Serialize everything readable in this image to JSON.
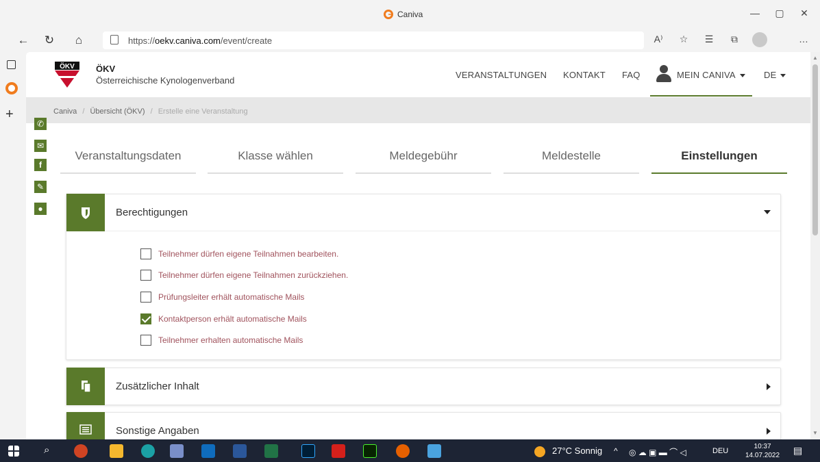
{
  "window": {
    "title": "Caniva"
  },
  "browser": {
    "url_prefix": "https://",
    "url_domain": "oekv.caniva.com",
    "url_path": "/event/create"
  },
  "site": {
    "brand": "ÖKV",
    "subtitle": "Österreichische Kynologenverband",
    "nav": {
      "events": "VERANSTALTUNGEN",
      "contact": "KONTAKT",
      "faq": "FAQ",
      "my_caniva": "MEIN CANIVA",
      "lang": "DE"
    }
  },
  "breadcrumb": {
    "home": "Caniva",
    "overview": "Übersicht (ÖKV)",
    "current": "Erstelle eine Veranstaltung",
    "sep": "/"
  },
  "tabs": [
    {
      "label": "Veranstaltungsdaten",
      "active": false
    },
    {
      "label": "Klasse wählen",
      "active": false
    },
    {
      "label": "Meldegebühr",
      "active": false
    },
    {
      "label": "Meldestelle",
      "active": false
    },
    {
      "label": "Einstellungen",
      "active": true
    }
  ],
  "panels": {
    "permissions": {
      "title": "Berechtigungen",
      "options": [
        {
          "label": "Teilnehmer dürfen eigene Teilnahmen bearbeiten.",
          "checked": false
        },
        {
          "label": "Teilnehmer dürfen eigene Teilnahmen zurückziehen.",
          "checked": false
        },
        {
          "label": "Prüfungsleiter erhält automatische Mails",
          "checked": false
        },
        {
          "label": "Kontaktperson erhält automatische Mails",
          "checked": true
        },
        {
          "label": "Teilnehmer erhalten automatische Mails",
          "checked": false
        }
      ]
    },
    "additional": {
      "title": "Zusätzlicher Inhalt"
    },
    "other": {
      "title": "Sonstige Angaben"
    }
  },
  "taskbar": {
    "weather": "27°C  Sonnig",
    "lang": "DEU",
    "time": "10:37",
    "date": "14.07.2022"
  },
  "colors": {
    "accent": "#5a7a2b",
    "option_text": "#a0525c",
    "taskbar": "#1d2434"
  }
}
